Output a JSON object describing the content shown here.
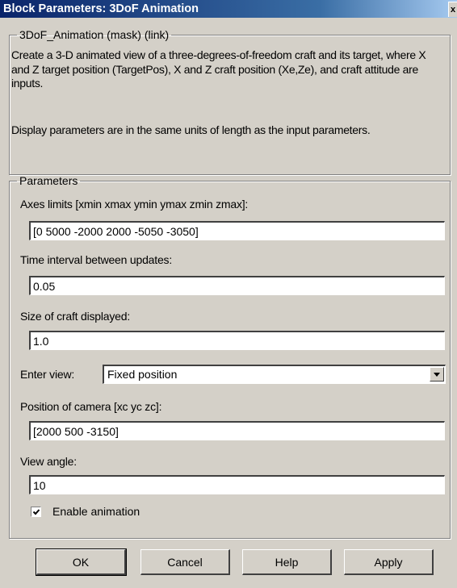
{
  "window": {
    "title": "Block Parameters: 3DoF Animation",
    "close_glyph": "x"
  },
  "mask": {
    "legend": "3DoF_Animation (mask) (link)",
    "description_1": "Create a 3-D animated view of a three-degrees-of-freedom craft and its target, where X and Z target position (TargetPos), X and Z craft position (Xe,Ze), and craft attitude are inputs.",
    "description_2": "Display parameters are in the same units of length as the input parameters."
  },
  "parameters": {
    "legend": "Parameters",
    "axes_limits": {
      "label": "Axes limits [xmin xmax ymin ymax zmin zmax]:",
      "value": "[0 5000 -2000 2000 -5050 -3050]"
    },
    "time_interval": {
      "label": "Time interval between updates:",
      "value": "0.05"
    },
    "craft_size": {
      "label": "Size of craft displayed:",
      "value": "1.0"
    },
    "enter_view": {
      "label": "Enter view:",
      "selected": "Fixed position"
    },
    "camera_position": {
      "label": "Position of camera [xc yc zc]:",
      "value": "[2000 500 -3150]"
    },
    "view_angle": {
      "label": "View angle:",
      "value": "10"
    },
    "enable_animation": {
      "label": "Enable animation",
      "checked": true
    }
  },
  "buttons": {
    "ok": "OK",
    "cancel": "Cancel",
    "help": "Help",
    "apply": "Apply"
  }
}
